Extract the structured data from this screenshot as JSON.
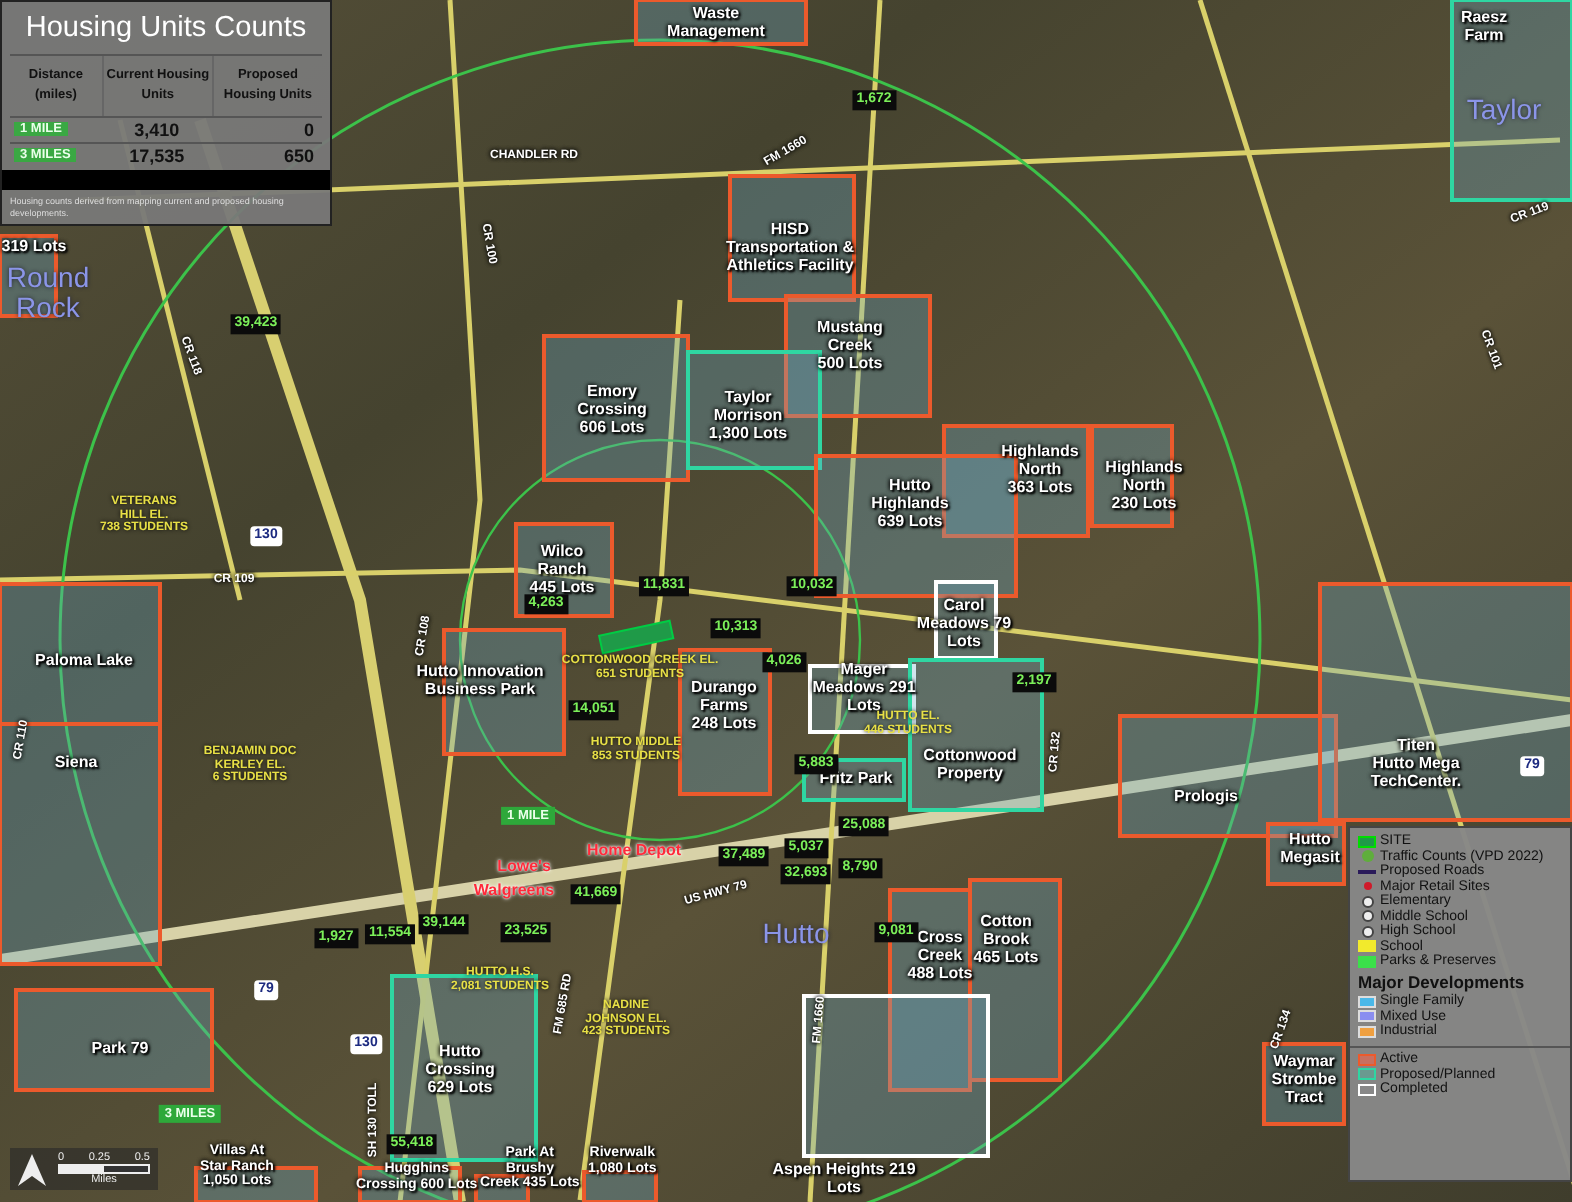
{
  "housing_table": {
    "title": "Housing Units Counts",
    "columns": [
      "Distance (miles)",
      "Current Housing Units",
      "Proposed Housing Units"
    ],
    "rows": [
      {
        "distance": "1 MILE",
        "current": "3,410",
        "proposed": "0"
      },
      {
        "distance": "3 MILES",
        "current": "17,535",
        "proposed": "650"
      }
    ],
    "note": "Housing counts derived from mapping current and proposed housing developments."
  },
  "map": {
    "developments": [
      {
        "label": "Waste\nManagement",
        "color": "#ec5a2c"
      },
      {
        "label": "HISD\nTransportation &\nAthletics Facility",
        "color": "#ec5a2c"
      },
      {
        "label": "Mustang\nCreek\n500 Lots",
        "color": "#ec5a2c"
      },
      {
        "label": "Emory\nCrossing\n606 Lots",
        "color": "#ec5a2c"
      },
      {
        "label": "Taylor\nMorrison\n1,300 Lots",
        "color": "#2fd6a2"
      },
      {
        "label": "Highlands\nNorth\n363 Lots",
        "color": "#ec5a2c"
      },
      {
        "label": "Highlands\nNorth\n230 Lots",
        "color": "#ec5a2c"
      },
      {
        "label": "Hutto\nHighlands\n639 Lots",
        "color": "#ec5a2c"
      },
      {
        "label": "Wilco\nRanch\n445 Lots",
        "color": "#ec5a2c"
      },
      {
        "label": "Carol\nMeadows 79\nLots",
        "color": "#ffffff"
      },
      {
        "label": "Mager\nMeadows 291\nLots",
        "color": "#ffffff"
      },
      {
        "label": "Durango\nFarms\n248 Lots",
        "color": "#ec5a2c"
      },
      {
        "label": "Hutto Innovation\nBusiness Park",
        "color": "#ec5a2c"
      },
      {
        "label": "Fritz Park",
        "color": "#2fd6a2"
      },
      {
        "label": "Cottonwood\nProperty",
        "color": "#2fd6a2"
      },
      {
        "label": "Prologis",
        "color": "#ec5a2c"
      },
      {
        "label": "Titen\nHutto Mega\nTechCenter.",
        "color": "#ec5a2c"
      },
      {
        "label": "Hutto\nMegasit",
        "color": "#ec5a2c"
      },
      {
        "label": "Waymar\nStrombe\nTract",
        "color": "#ec5a2c"
      },
      {
        "label": "Cross\nCreek\n488 Lots",
        "color": "#ec5a2c"
      },
      {
        "label": "Cotton\nBrook\n465 Lots",
        "color": "#ec5a2c"
      },
      {
        "label": "Hutto\nCrossing\n629 Lots",
        "color": "#2fd6a2"
      },
      {
        "label": "Villas At\nStar Ranch\n1,050 Lots",
        "color": "#ec5a2c"
      },
      {
        "label": "Hugghins\nCrossing 600 Lots",
        "color": "#ec5a2c"
      },
      {
        "label": "Park At\nBrushy\nCreek 435 Lots",
        "color": "#ec5a2c"
      },
      {
        "label": "Riverwalk\n1,080 Lots",
        "color": "#ec5a2c"
      },
      {
        "label": "Aspen Heights 219\nLots",
        "color": "#ffffff"
      },
      {
        "label": "Park 79",
        "color": "#ec5a2c"
      },
      {
        "label": "Paloma Lake",
        "color": "#ec5a2c"
      },
      {
        "label": "Siena",
        "color": "#ec5a2c"
      },
      {
        "label": "319 Lots",
        "color": "#ec5a2c"
      },
      {
        "label": "Raesz\nFarm",
        "color": "#2fd6a2"
      }
    ],
    "traffic_counts": [
      "1,672",
      "39,423",
      "11,831",
      "4,263",
      "10,032",
      "10,313",
      "4,026",
      "14,051",
      "2,197",
      "5,883",
      "25,088",
      "5,037",
      "37,489",
      "32,693",
      "8,790",
      "41,669",
      "1,927",
      "11,554",
      "39,144",
      "23,525",
      "9,081",
      "55,418"
    ],
    "schools": [
      "VETERANS\nHILL EL.\n738 STUDENTS",
      "BENJAMIN DOC\nKERLEY EL.\n6 STUDENTS",
      "COTTONWOOD CREEK EL.\n651 STUDENTS",
      "HUTTO MIDDLE\n853 STUDENTS",
      "HUTTO EL.\n446 STUDENTS",
      "HUTTO H.S.\n2,081 STUDENTS",
      "NADINE\nJOHNSON EL.\n423 STUDENTS"
    ],
    "retail": [
      "Lowe's",
      "Walgreens",
      "Home Depot"
    ],
    "towns": [
      "Round\nRock",
      "Taylor",
      "Hutto"
    ],
    "roads": [
      "CHANDLER RD",
      "FM 1660",
      "CR 100",
      "CR 118",
      "CR 109",
      "CR 108",
      "CR 101",
      "CR 119",
      "CR 132",
      "CR 134",
      "CR 110",
      "US HWY 79",
      "FM 685 RD",
      "SH 130 TOLL",
      "FM 1660"
    ],
    "shields": [
      "130",
      "130",
      "79",
      "79"
    ],
    "radius_labels": [
      "1 MILE",
      "3 MILES"
    ],
    "scale": [
      "0",
      "0.25",
      "0.5",
      "Miles"
    ]
  },
  "legend": {
    "items": [
      {
        "kind": "site",
        "label": "SITE"
      },
      {
        "kind": "traffic",
        "label": "Traffic Counts (VPD 2022)"
      },
      {
        "kind": "proposed-road",
        "label": "Proposed Roads"
      },
      {
        "kind": "retail",
        "label": "Major Retail Sites"
      },
      {
        "kind": "elementary",
        "label": "Elementary"
      },
      {
        "kind": "middle",
        "label": "Middle School"
      },
      {
        "kind": "high",
        "label": "High School"
      },
      {
        "kind": "school",
        "label": "School"
      },
      {
        "kind": "parks",
        "label": "Parks & Preserves"
      }
    ],
    "heading": "Major Developments",
    "types": [
      {
        "kind": "single-family",
        "label": "Single Family"
      },
      {
        "kind": "mixed-use",
        "label": "Mixed Use"
      },
      {
        "kind": "industrial",
        "label": "Industrial"
      }
    ],
    "statuses": [
      {
        "kind": "active",
        "label": "Active"
      },
      {
        "kind": "proposed",
        "label": "Proposed/Planned"
      },
      {
        "kind": "completed",
        "label": "Completed"
      }
    ]
  }
}
